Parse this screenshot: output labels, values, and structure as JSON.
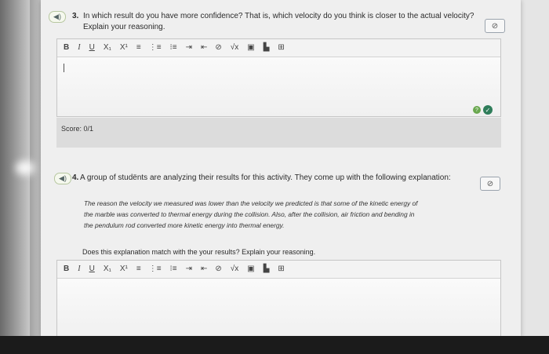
{
  "toolbar": {
    "bold": "B",
    "italic": "I",
    "underline": "U",
    "subscript": "X₁",
    "superscript": "X¹",
    "align": "≡",
    "ordered_list": "⋮≡",
    "unordered_list": "⁝≡",
    "indent": "⇥",
    "outdent": "⇤",
    "link": "⊘",
    "math": "√x",
    "image": "▣",
    "media": "▙",
    "table": "⊞"
  },
  "q3": {
    "speaker": "◀)",
    "number": "3.",
    "text_line1": "In which result do you have more confidence? That is, which velocity do you think is closer to the actual velocity?",
    "text_line2": "Explain your reasoning.",
    "link_icon": "⊘",
    "cursor": "|",
    "score": "Score: 0/1"
  },
  "q4": {
    "speaker": "◀)",
    "number": "4.",
    "text": "A group of studënts are analyzing their results for this activity. They come up with the following explanation:",
    "link_icon": "⊘",
    "quote_lines": [
      "The reason the velocity we measured was lower than the velocity we predicted is that some of the kinetic energy of",
      "the marble was converted to thermal energy during the collision. Also, after the collision, air friction and bending in",
      "the pendulum rod converted more kinetic energy into thermal energy."
    ],
    "followup": "Does this explanation match with the your results? Explain your reasoning."
  },
  "icons": {
    "hint": "?",
    "check": "✓"
  }
}
